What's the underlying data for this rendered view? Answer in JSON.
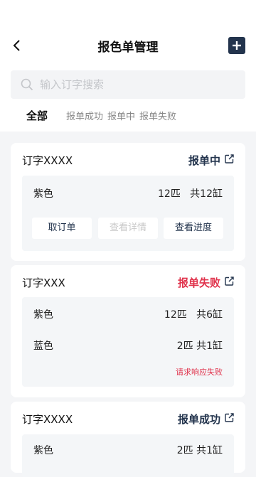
{
  "header": {
    "title": "报色单管理"
  },
  "search": {
    "placeholder": "输入订字搜索"
  },
  "tabs": [
    {
      "label": "全部",
      "active": true
    },
    {
      "label": "报单成功",
      "active": false
    },
    {
      "label": "报单中",
      "active": false
    },
    {
      "label": "报单失败",
      "active": false
    }
  ],
  "colors": {
    "in_progress": "#23344d",
    "failed": "#e0334c",
    "success": "#23344d"
  },
  "orders": [
    {
      "name": "订字XXXX",
      "status": "报单中",
      "items": [
        {
          "color": "紫色",
          "qty": "12匹   共12缸"
        }
      ],
      "buttons": {
        "cancel": "取订单",
        "detail": "查看详情",
        "progress": "查看进度"
      }
    },
    {
      "name": "订字XXX",
      "status": "报单失败",
      "items": [
        {
          "color": "紫色",
          "qty": "12匹   共6缸"
        },
        {
          "color": "蓝色",
          "qty": "2匹 共1缸"
        }
      ],
      "note": "请求响应失败"
    },
    {
      "name": "订字XXXX",
      "status": "报单成功",
      "items": [
        {
          "color": "紫色",
          "qty": "2匹 共1缸"
        }
      ]
    }
  ]
}
